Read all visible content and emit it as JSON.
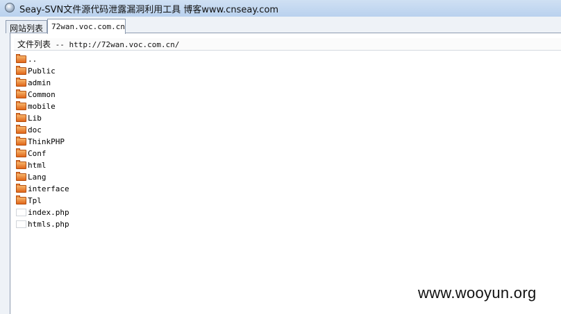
{
  "window": {
    "title": "Seay-SVN文件源代码泄露漏洞利用工具  博客www.cnseay.com"
  },
  "tabs": [
    {
      "label": "网站列表",
      "active": false
    },
    {
      "label": "72wan.voc.com.cn",
      "active": true
    }
  ],
  "pathbar": {
    "label": "文件列表",
    "separator": " -- ",
    "url": "http://72wan.voc.com.cn/"
  },
  "files": [
    {
      "name": "..",
      "type": "folder",
      "icon": "folder-icon"
    },
    {
      "name": "Public",
      "type": "folder",
      "icon": "folder-icon"
    },
    {
      "name": "admin",
      "type": "folder",
      "icon": "folder-icon"
    },
    {
      "name": "Common",
      "type": "folder",
      "icon": "folder-icon"
    },
    {
      "name": "mobile",
      "type": "folder",
      "icon": "folder-icon"
    },
    {
      "name": "Lib",
      "type": "folder",
      "icon": "folder-icon"
    },
    {
      "name": "doc",
      "type": "folder",
      "icon": "folder-icon"
    },
    {
      "name": "ThinkPHP",
      "type": "folder",
      "icon": "folder-icon"
    },
    {
      "name": "Conf",
      "type": "folder",
      "icon": "folder-icon"
    },
    {
      "name": "html",
      "type": "folder",
      "icon": "folder-icon"
    },
    {
      "name": "Lang",
      "type": "folder",
      "icon": "folder-icon"
    },
    {
      "name": "interface",
      "type": "folder",
      "icon": "folder-icon"
    },
    {
      "name": "Tpl",
      "type": "folder",
      "icon": "folder-icon"
    },
    {
      "name": "index.php",
      "type": "file",
      "icon": "file-icon"
    },
    {
      "name": "htmls.php",
      "type": "file",
      "icon": "file-icon"
    }
  ],
  "watermark": "www.wooyun.org",
  "colors": {
    "titlebar": "#b9d1ee",
    "folder": "#e0661a",
    "panel": "#ffffff"
  }
}
